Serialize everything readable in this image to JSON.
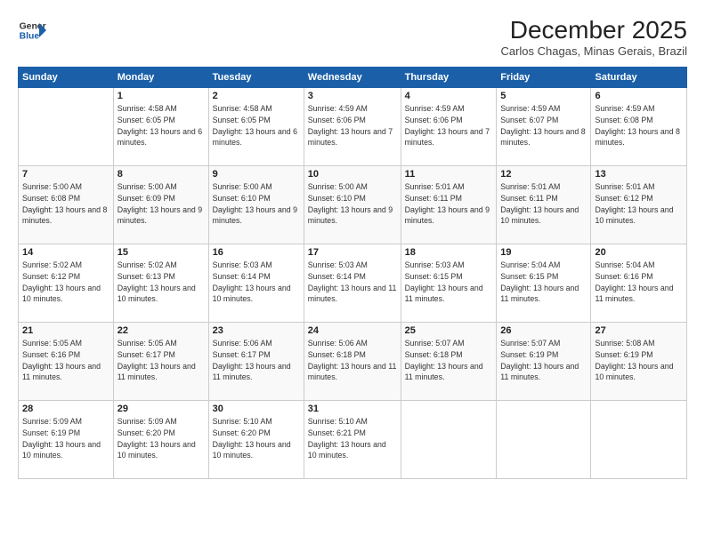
{
  "logo": {
    "line1": "General",
    "line2": "Blue"
  },
  "title": {
    "month_year": "December 2025",
    "location": "Carlos Chagas, Minas Gerais, Brazil"
  },
  "header": {
    "days": [
      "Sunday",
      "Monday",
      "Tuesday",
      "Wednesday",
      "Thursday",
      "Friday",
      "Saturday"
    ]
  },
  "weeks": [
    {
      "cells": [
        {
          "empty": true
        },
        {
          "day": "1",
          "sunrise": "4:58 AM",
          "sunset": "6:05 PM",
          "daylight": "13 hours and 6 minutes."
        },
        {
          "day": "2",
          "sunrise": "4:58 AM",
          "sunset": "6:05 PM",
          "daylight": "13 hours and 6 minutes."
        },
        {
          "day": "3",
          "sunrise": "4:59 AM",
          "sunset": "6:06 PM",
          "daylight": "13 hours and 7 minutes."
        },
        {
          "day": "4",
          "sunrise": "4:59 AM",
          "sunset": "6:06 PM",
          "daylight": "13 hours and 7 minutes."
        },
        {
          "day": "5",
          "sunrise": "4:59 AM",
          "sunset": "6:07 PM",
          "daylight": "13 hours and 8 minutes."
        },
        {
          "day": "6",
          "sunrise": "4:59 AM",
          "sunset": "6:08 PM",
          "daylight": "13 hours and 8 minutes."
        }
      ]
    },
    {
      "cells": [
        {
          "day": "7",
          "sunrise": "5:00 AM",
          "sunset": "6:08 PM",
          "daylight": "13 hours and 8 minutes."
        },
        {
          "day": "8",
          "sunrise": "5:00 AM",
          "sunset": "6:09 PM",
          "daylight": "13 hours and 9 minutes."
        },
        {
          "day": "9",
          "sunrise": "5:00 AM",
          "sunset": "6:10 PM",
          "daylight": "13 hours and 9 minutes."
        },
        {
          "day": "10",
          "sunrise": "5:00 AM",
          "sunset": "6:10 PM",
          "daylight": "13 hours and 9 minutes."
        },
        {
          "day": "11",
          "sunrise": "5:01 AM",
          "sunset": "6:11 PM",
          "daylight": "13 hours and 9 minutes."
        },
        {
          "day": "12",
          "sunrise": "5:01 AM",
          "sunset": "6:11 PM",
          "daylight": "13 hours and 10 minutes."
        },
        {
          "day": "13",
          "sunrise": "5:01 AM",
          "sunset": "6:12 PM",
          "daylight": "13 hours and 10 minutes."
        }
      ]
    },
    {
      "cells": [
        {
          "day": "14",
          "sunrise": "5:02 AM",
          "sunset": "6:12 PM",
          "daylight": "13 hours and 10 minutes."
        },
        {
          "day": "15",
          "sunrise": "5:02 AM",
          "sunset": "6:13 PM",
          "daylight": "13 hours and 10 minutes."
        },
        {
          "day": "16",
          "sunrise": "5:03 AM",
          "sunset": "6:14 PM",
          "daylight": "13 hours and 10 minutes."
        },
        {
          "day": "17",
          "sunrise": "5:03 AM",
          "sunset": "6:14 PM",
          "daylight": "13 hours and 11 minutes."
        },
        {
          "day": "18",
          "sunrise": "5:03 AM",
          "sunset": "6:15 PM",
          "daylight": "13 hours and 11 minutes."
        },
        {
          "day": "19",
          "sunrise": "5:04 AM",
          "sunset": "6:15 PM",
          "daylight": "13 hours and 11 minutes."
        },
        {
          "day": "20",
          "sunrise": "5:04 AM",
          "sunset": "6:16 PM",
          "daylight": "13 hours and 11 minutes."
        }
      ]
    },
    {
      "cells": [
        {
          "day": "21",
          "sunrise": "5:05 AM",
          "sunset": "6:16 PM",
          "daylight": "13 hours and 11 minutes."
        },
        {
          "day": "22",
          "sunrise": "5:05 AM",
          "sunset": "6:17 PM",
          "daylight": "13 hours and 11 minutes."
        },
        {
          "day": "23",
          "sunrise": "5:06 AM",
          "sunset": "6:17 PM",
          "daylight": "13 hours and 11 minutes."
        },
        {
          "day": "24",
          "sunrise": "5:06 AM",
          "sunset": "6:18 PM",
          "daylight": "13 hours and 11 minutes."
        },
        {
          "day": "25",
          "sunrise": "5:07 AM",
          "sunset": "6:18 PM",
          "daylight": "13 hours and 11 minutes."
        },
        {
          "day": "26",
          "sunrise": "5:07 AM",
          "sunset": "6:19 PM",
          "daylight": "13 hours and 11 minutes."
        },
        {
          "day": "27",
          "sunrise": "5:08 AM",
          "sunset": "6:19 PM",
          "daylight": "13 hours and 10 minutes."
        }
      ]
    },
    {
      "cells": [
        {
          "day": "28",
          "sunrise": "5:09 AM",
          "sunset": "6:19 PM",
          "daylight": "13 hours and 10 minutes."
        },
        {
          "day": "29",
          "sunrise": "5:09 AM",
          "sunset": "6:20 PM",
          "daylight": "13 hours and 10 minutes."
        },
        {
          "day": "30",
          "sunrise": "5:10 AM",
          "sunset": "6:20 PM",
          "daylight": "13 hours and 10 minutes."
        },
        {
          "day": "31",
          "sunrise": "5:10 AM",
          "sunset": "6:21 PM",
          "daylight": "13 hours and 10 minutes."
        },
        {
          "empty": true
        },
        {
          "empty": true
        },
        {
          "empty": true
        }
      ]
    }
  ]
}
